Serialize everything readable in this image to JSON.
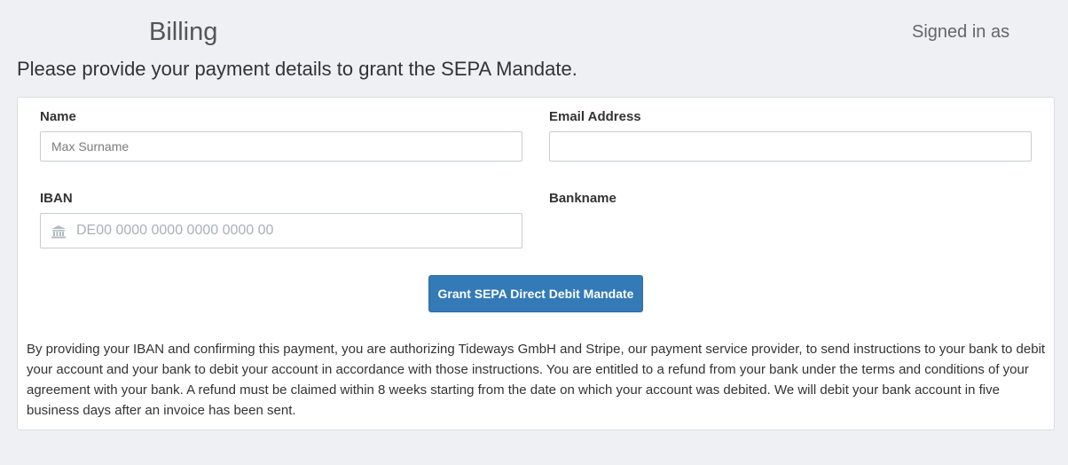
{
  "header": {
    "title": "Billing",
    "signed_in_label": "Signed in as"
  },
  "intro": "Please provide your payment details to grant the SEPA Mandate.",
  "form": {
    "name": {
      "label": "Name",
      "value": "",
      "placeholder": "Max Surname"
    },
    "email": {
      "label": "Email Address",
      "value": "",
      "placeholder": ""
    },
    "iban": {
      "label": "IBAN",
      "value": "",
      "placeholder": "DE00 0000 0000 0000 0000 00",
      "icon": "bank-icon"
    },
    "bankname": {
      "label": "Bankname",
      "value": ""
    },
    "submit_label": "Grant SEPA Direct Debit Mandate"
  },
  "legal_text": "By providing your IBAN and confirming this payment, you are authorizing Tideways GmbH and Stripe, our payment service provider, to send instructions to your bank to debit your account and your bank to debit your account in accordance with those instructions. You are entitled to a refund from your bank under the terms and conditions of your agreement with your bank. A refund must be claimed within 8 weeks starting from the date on which your account was debited. We will debit your bank account in five business days after an invoice has been sent.",
  "colors": {
    "background": "#eef0f4",
    "primary_button": "#337ab7",
    "panel": "#ffffff"
  }
}
